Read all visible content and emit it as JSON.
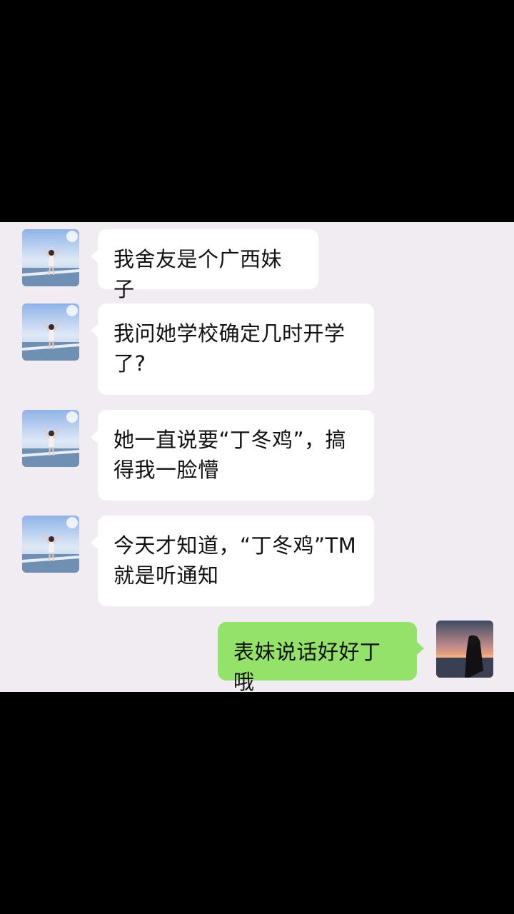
{
  "conversation": {
    "messages": [
      {
        "side": "in",
        "text": "我舍友是个广西妹子"
      },
      {
        "side": "in",
        "text": "我问她学校确定几时开学了?"
      },
      {
        "side": "in",
        "text": "她一直说要“丁冬鸡”，搞得我一脸懵"
      },
      {
        "side": "in",
        "text": "今天才知道，“丁冬鸡”TM就是听通知"
      },
      {
        "side": "out",
        "text": "表妹说话好好丁哦"
      }
    ]
  },
  "icons": {
    "contact_avatar": "contact-avatar-girl-arms-raised",
    "self_avatar": "self-avatar-girl-sunset"
  },
  "colors": {
    "chat_background": "#f1ecf2",
    "incoming_bubble": "#ffffff",
    "outgoing_bubble": "#95e26b"
  }
}
